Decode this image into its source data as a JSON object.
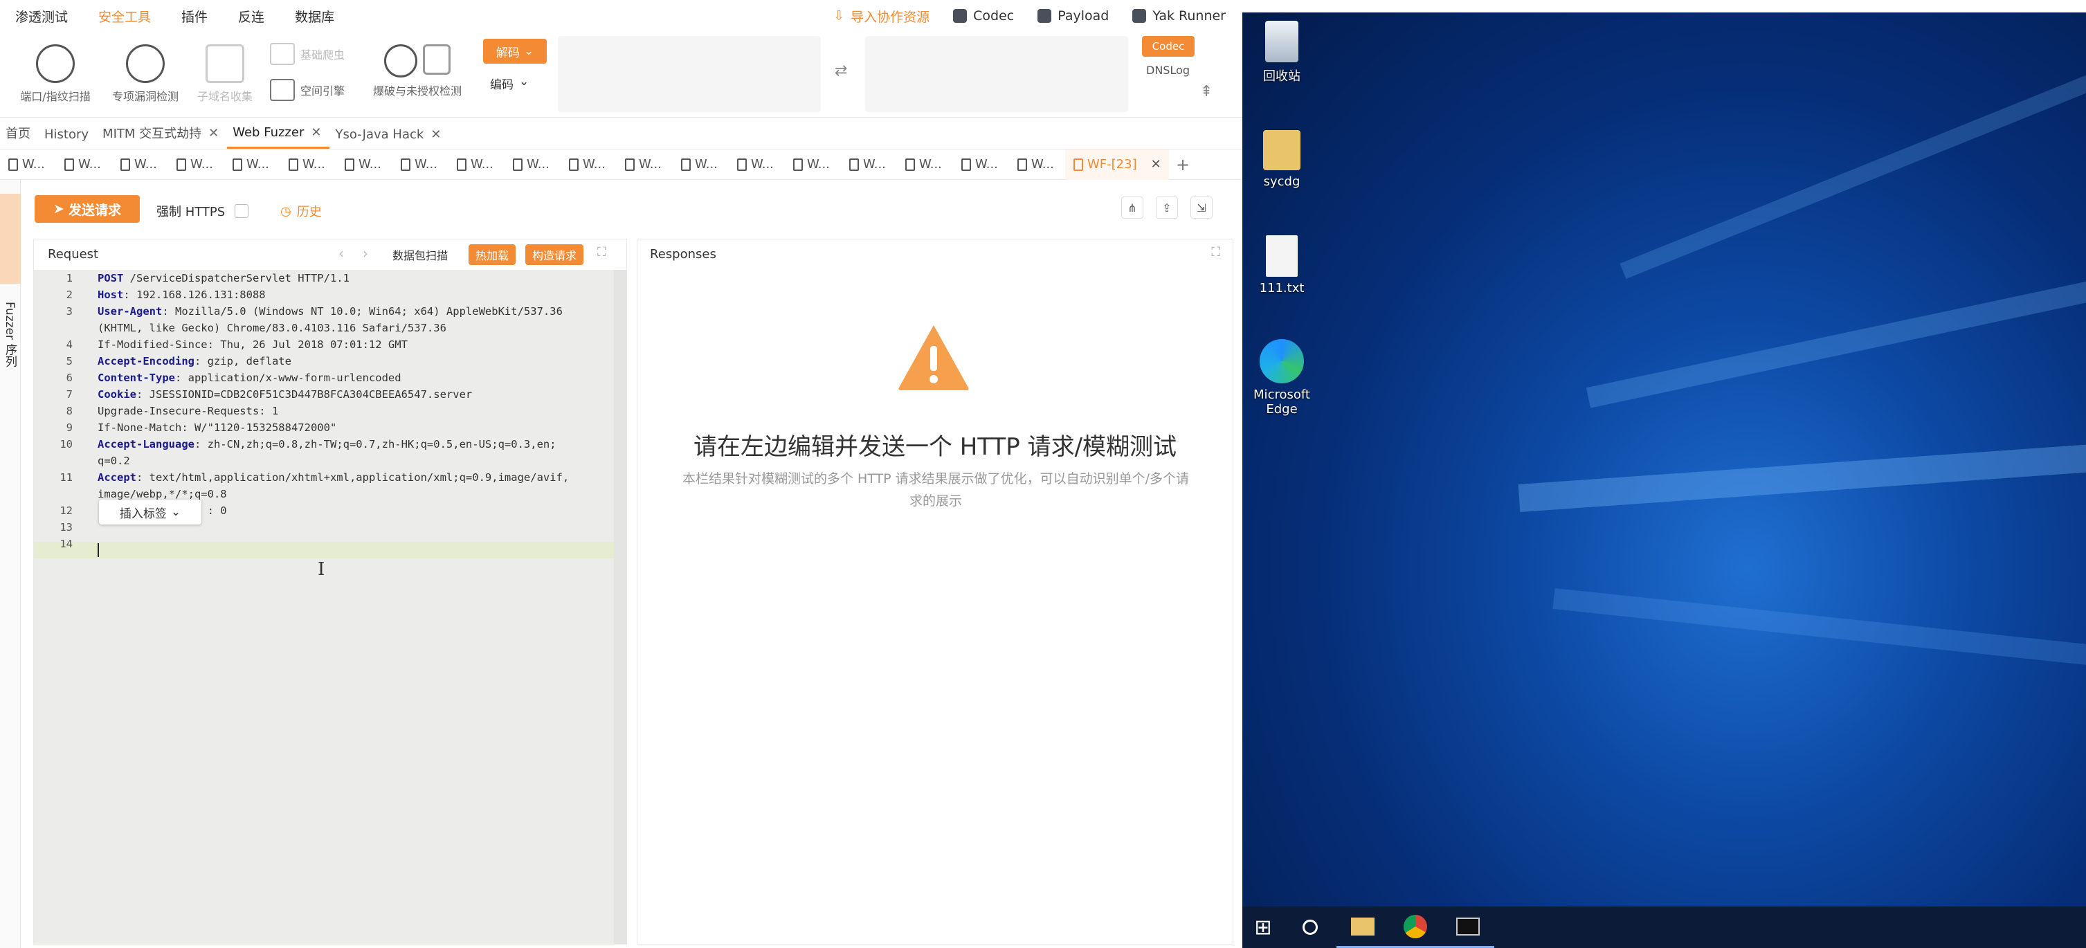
{
  "menu": {
    "items": [
      "渗透测试",
      "安全工具",
      "插件",
      "反连",
      "数据库"
    ],
    "active_index": 1,
    "right": {
      "import": "导入协作资源",
      "codec": "Codec",
      "payload": "Payload",
      "yak_runner": "Yak Runner"
    }
  },
  "toolbar": {
    "port_scan": "端口/指纹扫描",
    "vuln_detect": "专项漏洞检测",
    "subdomain": "子域名收集",
    "basic_crawler": "基础爬虫",
    "space_engine": "空间引擎",
    "brute": "爆破与未授权检测",
    "decode": "解码",
    "encode": "编码",
    "codec_btn": "Codec",
    "dnslog": "DNSLog"
  },
  "tabs": [
    {
      "label": "首页",
      "closable": false
    },
    {
      "label": "History",
      "closable": false
    },
    {
      "label": "MITM 交互式劫持",
      "closable": true
    },
    {
      "label": "Web Fuzzer",
      "closable": true,
      "active": true
    },
    {
      "label": "Yso-Java Hack",
      "closable": true
    }
  ],
  "subtabs": {
    "items": [
      "W...",
      "W...",
      "W...",
      "W...",
      "W...",
      "W...",
      "W...",
      "W...",
      "W...",
      "W...",
      "W...",
      "W...",
      "W...",
      "W...",
      "W...",
      "W...",
      "W...",
      "W...",
      "W...",
      "W..."
    ],
    "active": "WF-[23]"
  },
  "siderail": {
    "fuzzer": "Fuzzer 序列"
  },
  "fuzzer": {
    "send": "发送请求",
    "force_https": "强制 HTTPS",
    "history": "历史"
  },
  "request": {
    "title": "Request",
    "packet_scan": "数据包扫描",
    "hot_patch": "热加载",
    "build_request": "构造请求",
    "insert_tag": "插入标签",
    "lines": [
      {
        "n": "1",
        "key": "POST",
        "rest": " /ServiceDispatcherServlet HTTP/1.1"
      },
      {
        "n": "2",
        "key": "Host",
        "rest": ": 192.168.126.131:8088"
      },
      {
        "n": "3",
        "key": "User-Agent",
        "rest": ": Mozilla/5.0 (Windows NT 10.0; Win64; x64) AppleWebKit/537.36"
      },
      {
        "n": "",
        "key": "",
        "rest": "(KHTML, like Gecko) Chrome/83.0.4103.116 Safari/537.36"
      },
      {
        "n": "4",
        "key": "",
        "rest": "If-Modified-Since: Thu, 26 Jul 2018 07:01:12 GMT"
      },
      {
        "n": "5",
        "key": "Accept-Encoding",
        "rest": ": gzip, deflate"
      },
      {
        "n": "6",
        "key": "Content-Type",
        "rest": ": application/x-www-form-urlencoded"
      },
      {
        "n": "7",
        "key": "Cookie",
        "rest": ": JSESSIONID=CDB2C0F51C3D447B8FCA304CBEEA6547.server"
      },
      {
        "n": "8",
        "key": "",
        "rest": "Upgrade-Insecure-Requests: 1"
      },
      {
        "n": "9",
        "key": "",
        "rest": "If-None-Match: W/\"1120-1532588472000\""
      },
      {
        "n": "10",
        "key": "Accept-Language",
        "rest": ": zh-CN,zh;q=0.8,zh-TW;q=0.7,zh-HK;q=0.5,en-US;q=0.3,en;"
      },
      {
        "n": "",
        "key": "",
        "rest": "q=0.2"
      },
      {
        "n": "11",
        "key": "Accept",
        "rest": ": text/html,application/xhtml+xml,application/xml;q=0.9,image/avif,"
      },
      {
        "n": "",
        "key": "",
        "rest": "image/webp,*/*;q=0.8"
      },
      {
        "n": "12",
        "key": "",
        "rest": "                 : 0"
      },
      {
        "n": "13",
        "key": "",
        "rest": ""
      },
      {
        "n": "14",
        "key": "",
        "rest": ""
      }
    ]
  },
  "responses": {
    "title": "Responses",
    "empty_title": "请在左边编辑并发送一个 HTTP 请求/模糊测试",
    "empty_desc": "本栏结果针对模糊测试的多个 HTTP 请求结果展示做了优化，可以自动识别单个/多个请求的展示"
  },
  "desktop": {
    "icons": [
      {
        "label": "回收站",
        "icon": "recycle-bin-icon"
      },
      {
        "label": "sycdg",
        "icon": "folder-icon"
      },
      {
        "label": "111.txt",
        "icon": "text-file-icon"
      },
      {
        "label": "Microsoft Edge",
        "icon": "edge-icon"
      }
    ]
  },
  "colors": {
    "accent": "#f28b34"
  }
}
